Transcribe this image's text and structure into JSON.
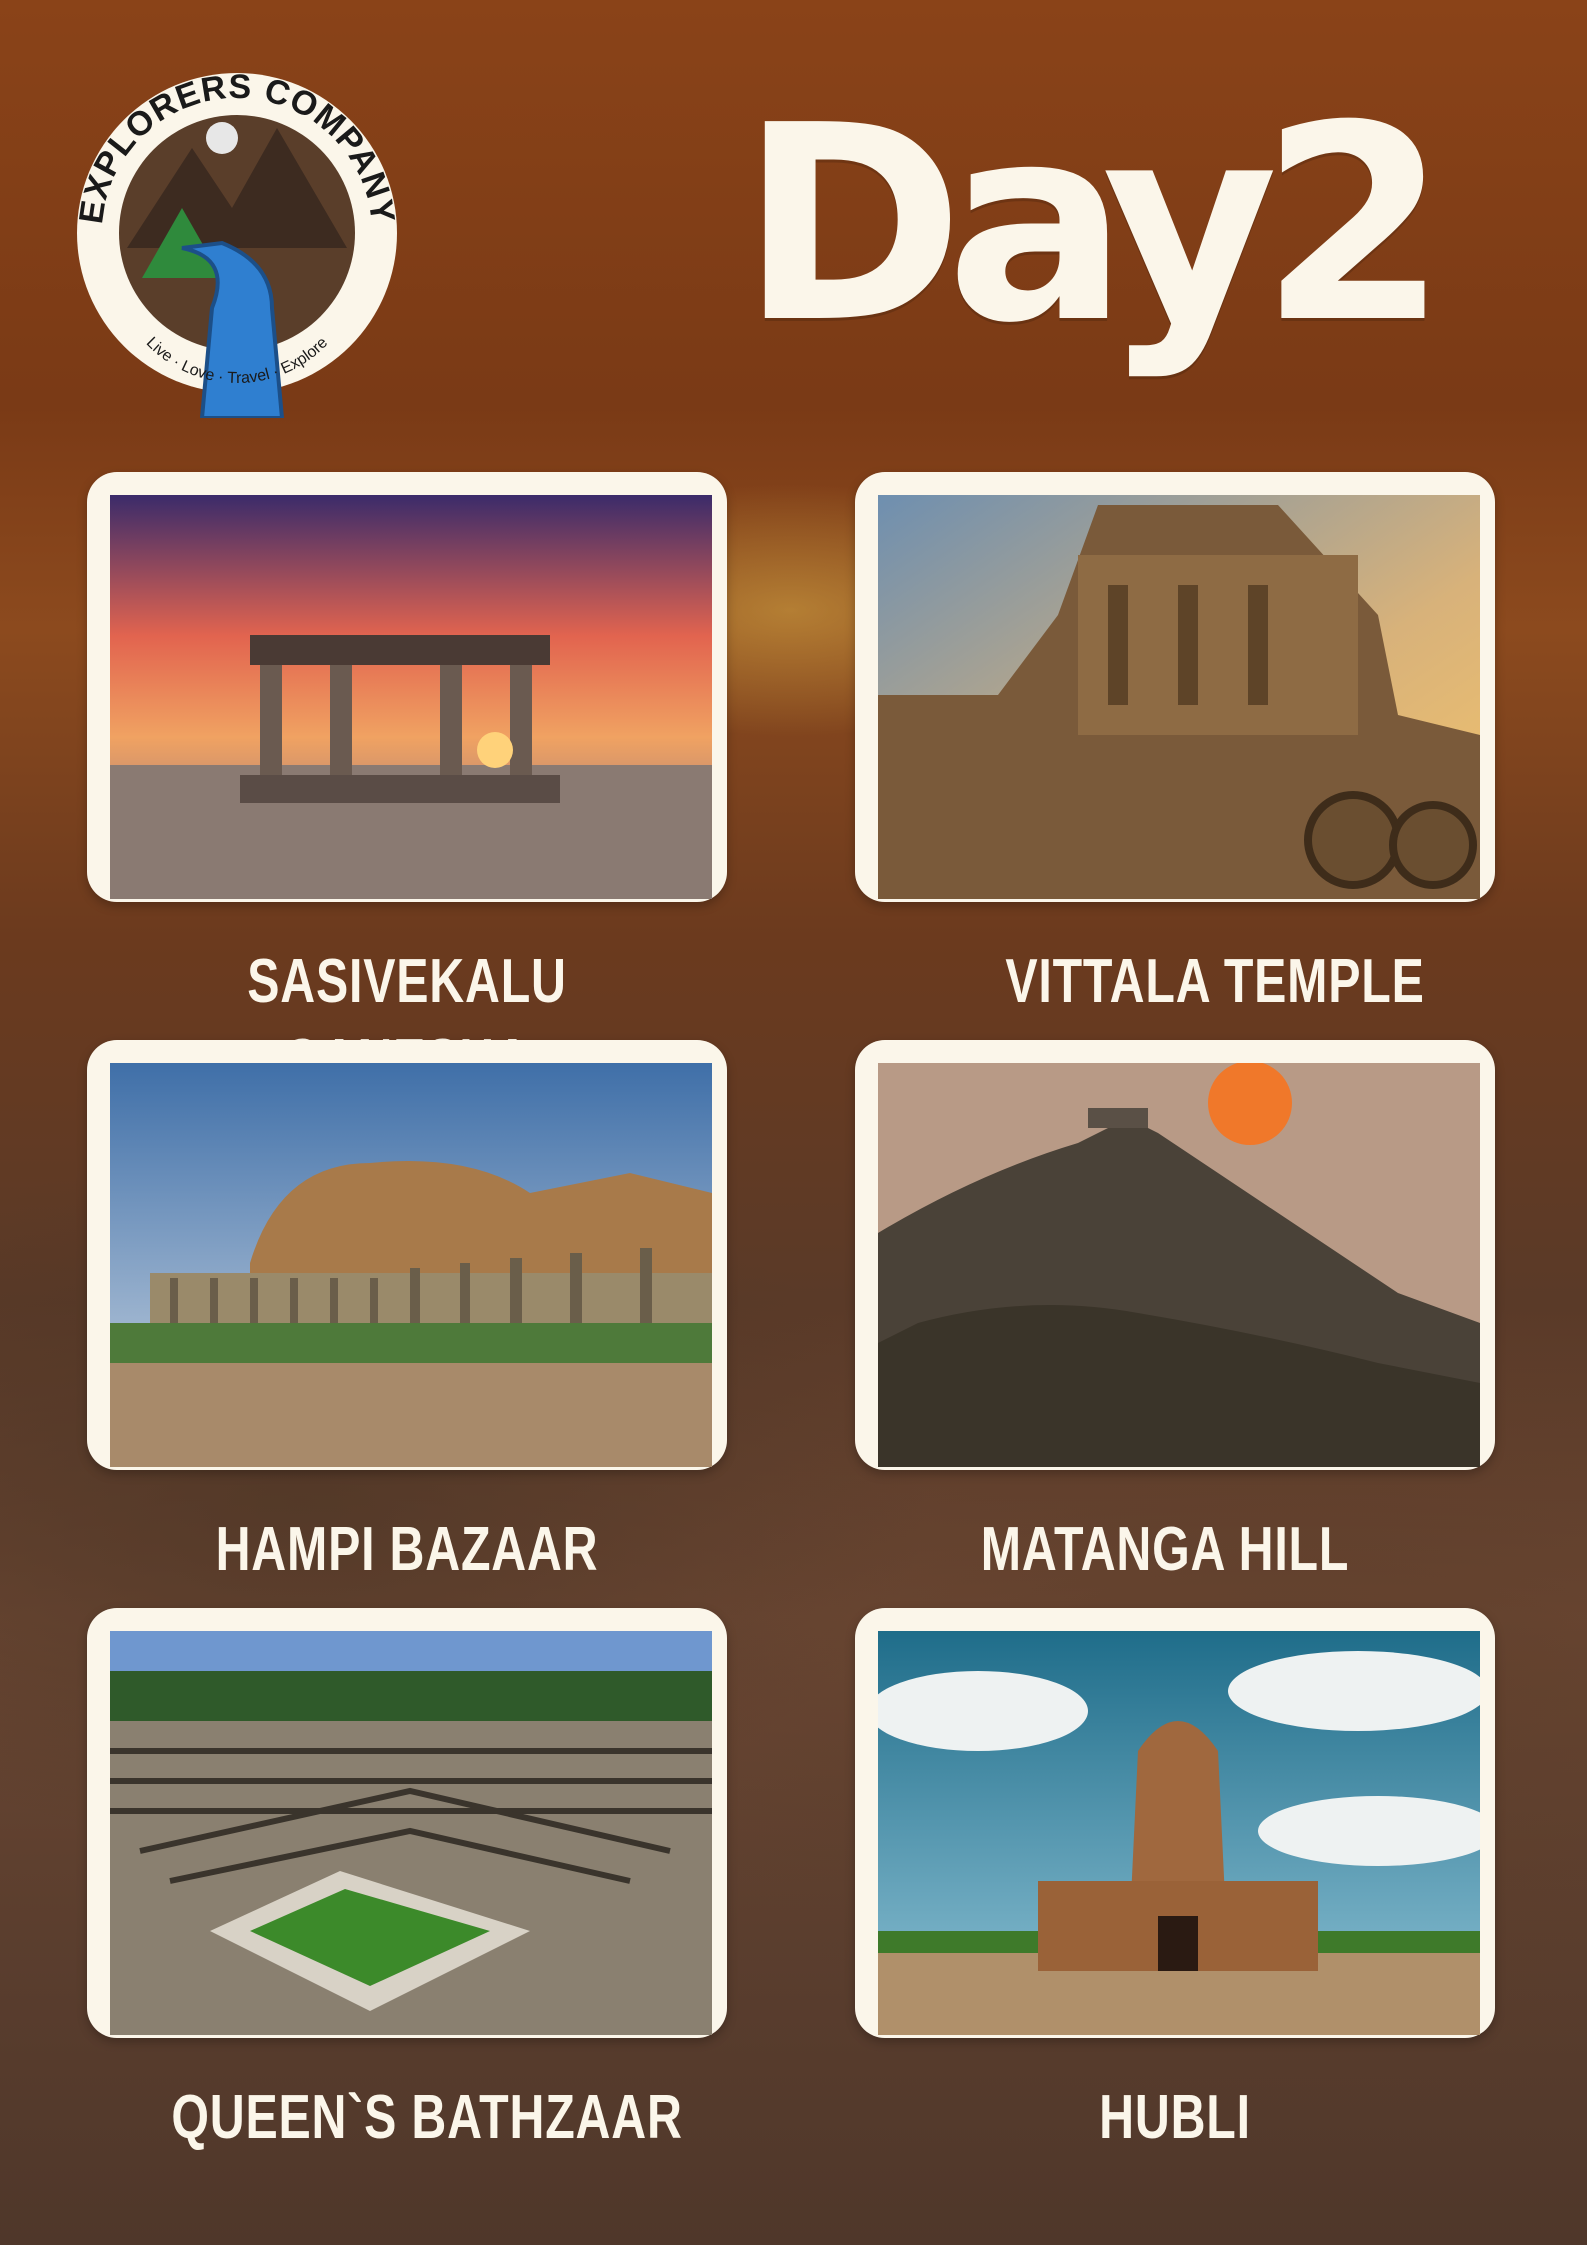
{
  "logo": {
    "text": "EXPLORERS COMPANY",
    "tagline": "Live · Love · Travel · Explore"
  },
  "title": "Day2",
  "places": [
    {
      "name": "SASIVEKALU GANESHA"
    },
    {
      "name": "VITTALA TEMPLE"
    },
    {
      "name": "HAMPI BAZAAR"
    },
    {
      "name": "MATANGA HILL"
    },
    {
      "name": "QUEEN`S BATHZAAR"
    },
    {
      "name": "HUBLI"
    }
  ],
  "colors": {
    "card": "#fbf6ea",
    "text": "#fbf6ea",
    "background": "#7a3a16"
  }
}
